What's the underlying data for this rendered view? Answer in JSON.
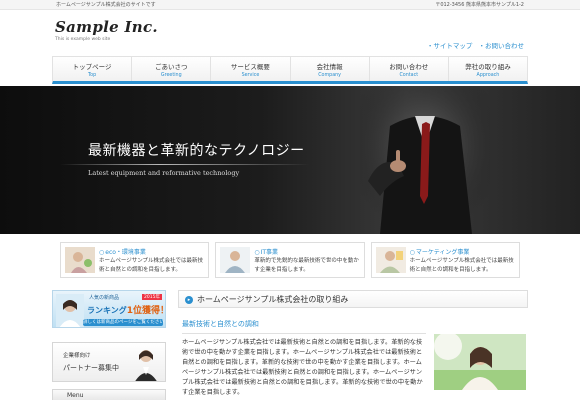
{
  "topbar": {
    "tagline": "ホームページサンプル株式会社のサイトです",
    "address": "〒012-3456 熊本県熊本市サンプル1-2"
  },
  "logo": {
    "name": "Sample Inc.",
    "sub": "This is example web site"
  },
  "util_links": [
    "・サイトマップ",
    "・お問い合わせ"
  ],
  "gnav": [
    {
      "jp": "トップページ",
      "en": "Top"
    },
    {
      "jp": "ごあいさつ",
      "en": "Greeting"
    },
    {
      "jp": "サービス概要",
      "en": "Service"
    },
    {
      "jp": "会社情報",
      "en": "Company"
    },
    {
      "jp": "お問い合わせ",
      "en": "Contact"
    },
    {
      "jp": "弊社の取り組み",
      "en": "Approach"
    }
  ],
  "hero": {
    "headline": "最新機器と革新的なテクノロジー",
    "sub": "Latest equipment and reformative technology"
  },
  "features": [
    {
      "title": "eco・環境事業",
      "desc": "ホームページサンプル株式会社では最新技術と自然との調和を目指します。"
    },
    {
      "title": "IT事業",
      "desc": "革新的で先鋭的な最新技術で世の中を動かす企業を目指します。"
    },
    {
      "title": "マーケティング事業",
      "desc": "ホームページサンプル株式会社では最新技術と自然との調和を目指します。"
    }
  ],
  "sidebar": {
    "banner1_top": "人気の新商品",
    "banner1_badge": "2015年",
    "banner1_main_a": "ランキング",
    "banner1_main_b": "1位獲得！",
    "banner1_link": "詳しくは新商品のページをご覧ください",
    "banner2_top": "企業様向け",
    "banner2_main": "パートナー募集中",
    "menu_label": "Menu"
  },
  "main": {
    "heading": "ホームページサンプル株式会社の取り組み",
    "subheading": "最新技術と自然との調和",
    "body": "ホームページサンプル株式会社では最新技術と自然との調和を目指します。革新的な技術で世の中を動かす企業を目指します。ホームページサンプル株式会社では最新技術と自然との調和を目指します。革新的な技術で世の中を動かす企業を目指します。ホームページサンプル株式会社では最新技術と自然との調和を目指します。ホームページサンプル株式会社では最新技術と自然との調和を目指します。革新的な技術で世の中を動かす企業を目指します。"
  },
  "colors": {
    "accent": "#2a8fcf",
    "hero_bg": "#111111",
    "page_bg": "#ffffff"
  },
  "icons": {
    "heading": "arrow-icon",
    "features": [
      "eco-photo-icon",
      "it-photo-icon",
      "marketing-photo-icon"
    ]
  }
}
